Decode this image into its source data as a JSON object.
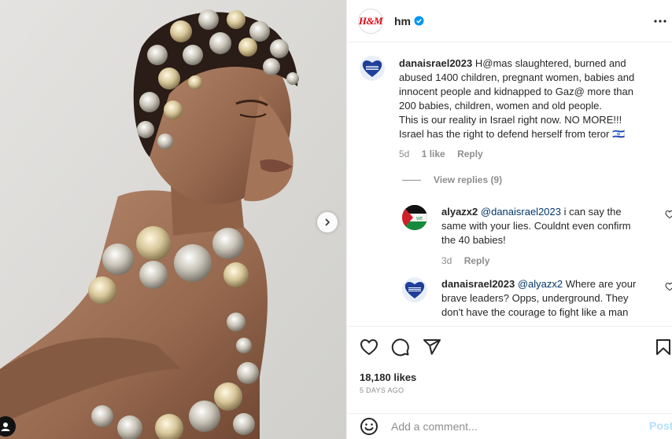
{
  "header": {
    "logo_text": "H&M",
    "username": "hm",
    "verified_icon": "verified-badge-icon",
    "more_icon": "more-dots-icon"
  },
  "media": {
    "next_icon": "chevron-right-icon"
  },
  "comments": [
    {
      "username": "danaisrael2023",
      "text_lines": [
        "H@mas slaughtered, burned and",
        "abused 1400 children, pregnant women, babies and",
        "innocent people and kidnapped to Gaz@ more than",
        "200 babies, children, women and old people.",
        "This is our reality in Israel right now. NO MORE!!!",
        "Israel has the right to defend herself from teror ‫‬🇮🇱"
      ],
      "time": "5d",
      "likes": "1 like",
      "reply": "Reply"
    }
  ],
  "view_replies": "View replies (9)",
  "replies": [
    {
      "username": "alyazx2",
      "mention": "@danaisrael2023",
      "line1_rest": " i can say the",
      "line2": "same with your lies. Couldnt even confirm",
      "line3": "the 40 babies!",
      "time": "3d",
      "reply": "Reply"
    },
    {
      "username": "danaisrael2023",
      "mention": "@alyazx2",
      "line1_rest": " Where are your",
      "line2": "brave leaders? Opps, underground. They",
      "line3": "don't have the courage to fight like a man"
    }
  ],
  "actions": {
    "like_icon": "heart-icon",
    "comment_icon": "comment-icon",
    "share_icon": "share-icon",
    "save_icon": "bookmark-icon",
    "likes": "18,180 likes",
    "date": "5 DAYS AGO"
  },
  "add_comment": {
    "emoji_icon": "emoji-icon",
    "placeholder": "Add a comment...",
    "post_label": "Post"
  },
  "colors": {
    "link": "#00376b",
    "verified": "#0095f6",
    "muted": "#8e8e8e",
    "post_disabled": "#b2dffc",
    "brand": "#e50010"
  }
}
